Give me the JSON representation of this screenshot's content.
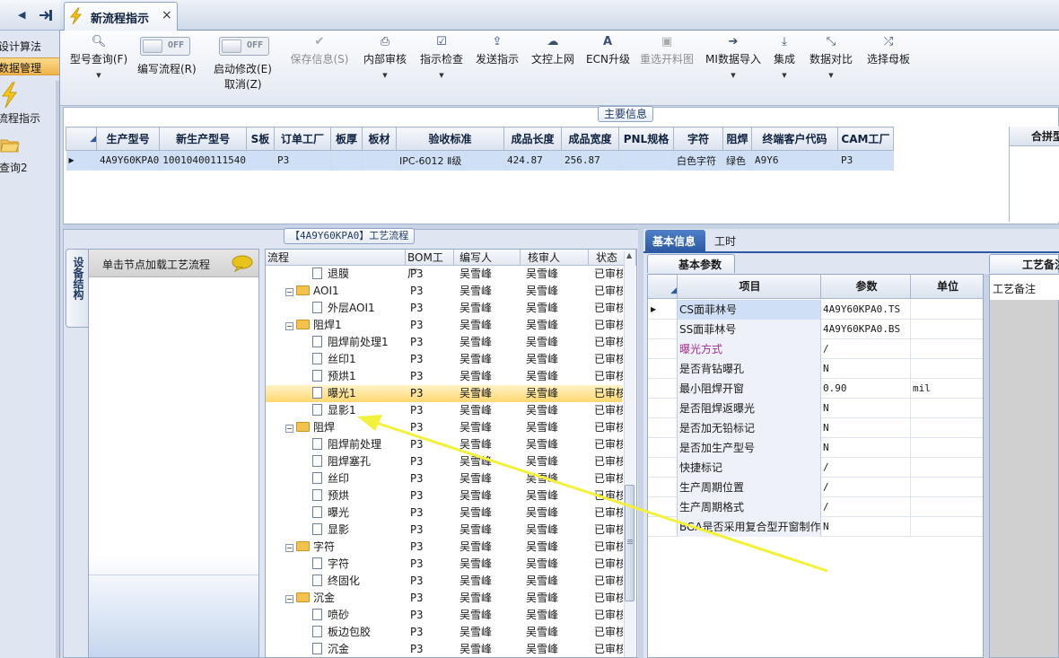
{
  "leftnav": {
    "item1": "设计算法",
    "item2": "数据管理",
    "item3": "流程指示",
    "item4": "查询2",
    "back_icon": "triangle-left-icon",
    "pin_icon": "arrow-into-box-icon"
  },
  "tab": {
    "label": "新流程指示",
    "close": "×"
  },
  "toolbar": {
    "query": "型号查询(F)",
    "write_flow": "编写流程(R)",
    "start_modify": "启动修改(E)",
    "cancel": "取消(Z)",
    "off1": "OFF",
    "off2": "OFF",
    "save": "保存信息(S)",
    "internal_review": "内部审核",
    "indicator_check": "指示检查",
    "send": "发送指示",
    "upload": "文控上网",
    "ecn": "ECN升级",
    "reselect": "重选开料图",
    "mi_import": "MI数据导入",
    "integrate": "集成",
    "compare": "数据对比",
    "select_mother": "选择母板"
  },
  "main_info": {
    "title": "主要信息",
    "side_title": "合拼型",
    "columns": [
      "生产型号",
      "新生产型号",
      "S板",
      "订单工厂",
      "板厚",
      "板材",
      "验收标准",
      "成品长度",
      "成品宽度",
      "PNL规格",
      "字符",
      "阻焊",
      "终端客户代码",
      "CAM工厂"
    ],
    "row": [
      "4A9Y60KPA0",
      "10010400111540",
      "",
      "P3",
      "",
      "",
      "IPC-6012 Ⅱ级",
      "424.87",
      "256.87",
      "",
      "白色字符",
      "绿色",
      "A9Y6",
      "P3"
    ]
  },
  "process": {
    "title": "【4A9Y60KPA0】工艺流程",
    "equip_tab": "设备结构",
    "equip_hint": "单击节点加载工艺流程",
    "columns": [
      "流程",
      "BOM工厂",
      "编写人",
      "核审人",
      "状态"
    ],
    "rows": [
      {
        "name": "退膜",
        "level": 2,
        "type": "doc",
        "bom": "P3",
        "writer": "吴雪峰",
        "reviewer": "吴雪峰",
        "status": "已审核"
      },
      {
        "name": "AOI1",
        "level": 1,
        "type": "folder",
        "bom": "P3",
        "writer": "吴雪峰",
        "reviewer": "吴雪峰",
        "status": "已审核"
      },
      {
        "name": "外层AOI1",
        "level": 2,
        "type": "doc",
        "bom": "P3",
        "writer": "吴雪峰",
        "reviewer": "吴雪峰",
        "status": "已审核"
      },
      {
        "name": "阻焊1",
        "level": 1,
        "type": "folder",
        "bom": "P3",
        "writer": "吴雪峰",
        "reviewer": "吴雪峰",
        "status": "已审核"
      },
      {
        "name": "阻焊前处理1",
        "level": 2,
        "type": "doc",
        "bom": "P3",
        "writer": "吴雪峰",
        "reviewer": "吴雪峰",
        "status": "已审核"
      },
      {
        "name": "丝印1",
        "level": 2,
        "type": "doc",
        "bom": "P3",
        "writer": "吴雪峰",
        "reviewer": "吴雪峰",
        "status": "已审核"
      },
      {
        "name": "预烘1",
        "level": 2,
        "type": "doc",
        "bom": "P3",
        "writer": "吴雪峰",
        "reviewer": "吴雪峰",
        "status": "已审核"
      },
      {
        "name": "曝光1",
        "level": 2,
        "type": "doc",
        "bom": "P3",
        "writer": "吴雪峰",
        "reviewer": "吴雪峰",
        "status": "已审核",
        "selected": true
      },
      {
        "name": "显影1",
        "level": 2,
        "type": "doc",
        "bom": "P3",
        "writer": "吴雪峰",
        "reviewer": "吴雪峰",
        "status": "已审核"
      },
      {
        "name": "阻焊",
        "level": 1,
        "type": "folder",
        "bom": "P3",
        "writer": "吴雪峰",
        "reviewer": "吴雪峰",
        "status": "已审核"
      },
      {
        "name": "阻焊前处理",
        "level": 2,
        "type": "doc",
        "bom": "P3",
        "writer": "吴雪峰",
        "reviewer": "吴雪峰",
        "status": "已审核"
      },
      {
        "name": "阻焊塞孔",
        "level": 2,
        "type": "doc",
        "bom": "P3",
        "writer": "吴雪峰",
        "reviewer": "吴雪峰",
        "status": "已审核"
      },
      {
        "name": "丝印",
        "level": 2,
        "type": "doc",
        "bom": "P3",
        "writer": "吴雪峰",
        "reviewer": "吴雪峰",
        "status": "已审核"
      },
      {
        "name": "预烘",
        "level": 2,
        "type": "doc",
        "bom": "P3",
        "writer": "吴雪峰",
        "reviewer": "吴雪峰",
        "status": "已审核"
      },
      {
        "name": "曝光",
        "level": 2,
        "type": "doc",
        "bom": "P3",
        "writer": "吴雪峰",
        "reviewer": "吴雪峰",
        "status": "已审核"
      },
      {
        "name": "显影",
        "level": 2,
        "type": "doc",
        "bom": "P3",
        "writer": "吴雪峰",
        "reviewer": "吴雪峰",
        "status": "已审核"
      },
      {
        "name": "字符",
        "level": 1,
        "type": "folder",
        "bom": "P3",
        "writer": "吴雪峰",
        "reviewer": "吴雪峰",
        "status": "已审核"
      },
      {
        "name": "字符",
        "level": 2,
        "type": "doc",
        "bom": "P3",
        "writer": "吴雪峰",
        "reviewer": "吴雪峰",
        "status": "已审核"
      },
      {
        "name": "终固化",
        "level": 2,
        "type": "doc",
        "bom": "P3",
        "writer": "吴雪峰",
        "reviewer": "吴雪峰",
        "status": "已审核"
      },
      {
        "name": "沉金",
        "level": 1,
        "type": "folder",
        "bom": "P3",
        "writer": "吴雪峰",
        "reviewer": "吴雪峰",
        "status": "已审核"
      },
      {
        "name": "喷砂",
        "level": 2,
        "type": "doc",
        "bom": "P3",
        "writer": "吴雪峰",
        "reviewer": "吴雪峰",
        "status": "已审核"
      },
      {
        "name": "板边包胶",
        "level": 2,
        "type": "doc",
        "bom": "P3",
        "writer": "吴雪峰",
        "reviewer": "吴雪峰",
        "status": "已审核"
      },
      {
        "name": "沉金",
        "level": 2,
        "type": "doc",
        "bom": "P3",
        "writer": "吴雪峰",
        "reviewer": "吴雪峰",
        "status": "已审核"
      }
    ]
  },
  "right": {
    "tab_basic": "基本信息",
    "tab_hours": "工时",
    "subtab": "基本参数",
    "remark_tab": "工艺备注",
    "remark_col": "工艺备注",
    "columns": [
      "项目",
      "参数",
      "单位"
    ],
    "rows": [
      {
        "item": "CS面菲林号",
        "param": "4A9Y60KPA0.TS",
        "unit": "",
        "current": true
      },
      {
        "item": "SS面菲林号",
        "param": "4A9Y60KPA0.BS",
        "unit": ""
      },
      {
        "item": "曝光方式",
        "param": "/",
        "unit": "",
        "highlight": true
      },
      {
        "item": "是否背钻曝孔",
        "param": "N",
        "unit": ""
      },
      {
        "item": "最小阻焊开窗",
        "param": "0.90",
        "unit": "mil"
      },
      {
        "item": "是否阻焊返曝光",
        "param": "N",
        "unit": ""
      },
      {
        "item": "是否加无铅标记",
        "param": "N",
        "unit": ""
      },
      {
        "item": "是否加生产型号",
        "param": "N",
        "unit": ""
      },
      {
        "item": "快捷标记",
        "param": "/",
        "unit": ""
      },
      {
        "item": "生产周期位置",
        "param": "/",
        "unit": ""
      },
      {
        "item": "生产周期格式",
        "param": "/",
        "unit": ""
      },
      {
        "item": "BGA是否采用复合型开窗制作",
        "param": "N",
        "unit": ""
      }
    ]
  },
  "colors": {
    "accent": "#2d5ba3",
    "selected_row": "#ffd86f",
    "annotation_arrow": "#f2f23a",
    "link_text": "#a0308c"
  }
}
